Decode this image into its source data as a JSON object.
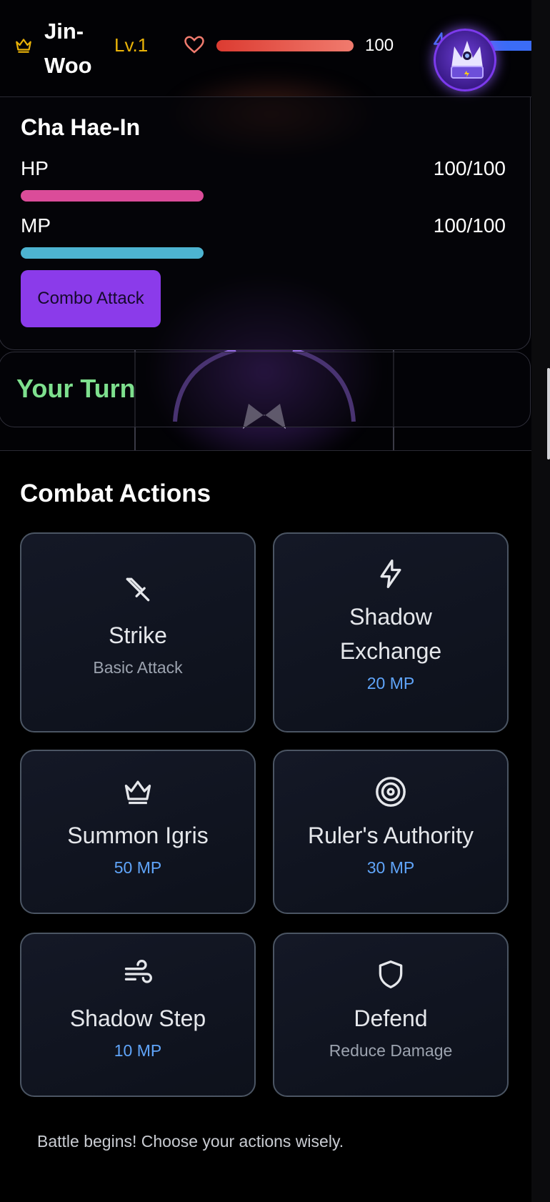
{
  "player": {
    "name": "Jin-\nWoo",
    "level": "Lv.1",
    "hp_value": "100",
    "hp_fraction": 1.0,
    "mp_fraction": 1.0
  },
  "companion": {
    "name": "Cha Hae-In",
    "hp_label": "HP",
    "hp_value": "100/100",
    "mp_label": "MP",
    "mp_value": "100/100",
    "combo_label": "Combo Attack"
  },
  "turn": {
    "label": "Your Turn"
  },
  "actions": {
    "title": "Combat Actions",
    "items": [
      {
        "icon": "sword-icon",
        "name": "Strike",
        "detail": "Basic Attack",
        "detail_type": "sub"
      },
      {
        "icon": "lightning-icon",
        "name": "Shadow\nExchange",
        "detail": "20 MP",
        "detail_type": "cost"
      },
      {
        "icon": "crown-icon",
        "name": "Summon Igris",
        "detail": "50 MP",
        "detail_type": "cost"
      },
      {
        "icon": "target-icon",
        "name": "Ruler's Authority",
        "detail": "30 MP",
        "detail_type": "cost"
      },
      {
        "icon": "wind-icon",
        "name": "Shadow Step",
        "detail": "10 MP",
        "detail_type": "cost"
      },
      {
        "icon": "shield-icon",
        "name": "Defend",
        "detail": "Reduce Damage",
        "detail_type": "sub"
      }
    ]
  },
  "log": {
    "message": "Battle begins! Choose your actions wisely."
  },
  "colors": {
    "hp_gradient_start": "#dc3b31",
    "mp_bar": "#3b6cf6",
    "companion_hp": "#db4c99",
    "companion_mp": "#4db4d1",
    "accent_purple": "#8b3bea",
    "turn_green": "#7ee08e",
    "mp_cost_blue": "#60a5fa",
    "level_gold": "#eab308"
  }
}
